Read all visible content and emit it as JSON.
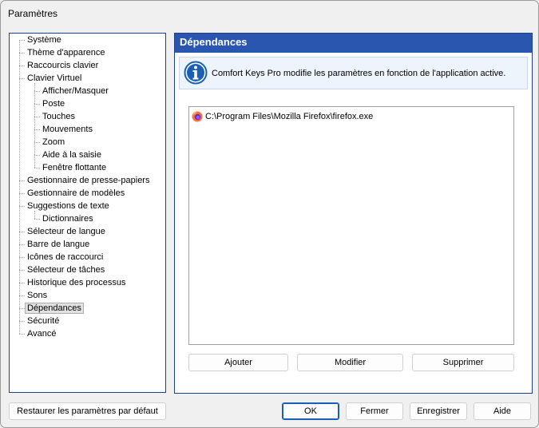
{
  "window": {
    "title": "Paramètres"
  },
  "tree": {
    "items": [
      {
        "label": "Système",
        "level": 0
      },
      {
        "label": "Thème d'apparence",
        "level": 0
      },
      {
        "label": "Raccourcis clavier",
        "level": 0
      },
      {
        "label": "Clavier Virtuel",
        "level": 0
      },
      {
        "label": "Afficher/Masquer",
        "level": 1
      },
      {
        "label": "Poste",
        "level": 1
      },
      {
        "label": "Touches",
        "level": 1
      },
      {
        "label": "Mouvements",
        "level": 1
      },
      {
        "label": "Zoom",
        "level": 1
      },
      {
        "label": "Aide à la saisie",
        "level": 1
      },
      {
        "label": "Fenêtre flottante",
        "level": 1
      },
      {
        "label": "Gestionnaire de presse-papiers",
        "level": 0
      },
      {
        "label": "Gestionnaire de modèles",
        "level": 0
      },
      {
        "label": "Suggestions de texte",
        "level": 0
      },
      {
        "label": "Dictionnaires",
        "level": 1
      },
      {
        "label": "Sélecteur de langue",
        "level": 0
      },
      {
        "label": "Barre de langue",
        "level": 0
      },
      {
        "label": "Icônes de raccourci",
        "level": 0
      },
      {
        "label": "Sélecteur de tâches",
        "level": 0
      },
      {
        "label": "Historique des processus",
        "level": 0
      },
      {
        "label": "Sons",
        "level": 0
      },
      {
        "label": "Dépendances",
        "level": 0,
        "selected": true
      },
      {
        "label": "Sécurité",
        "level": 0
      },
      {
        "label": "Avancé",
        "level": 0
      }
    ]
  },
  "panel": {
    "header": "Dépendances",
    "info_text": "Comfort Keys Pro modifie les paramètres en fonction de l'application active.",
    "list": [
      {
        "icon": "firefox-icon",
        "path": "C:\\Program Files\\Mozilla Firefox\\firefox.exe"
      }
    ],
    "buttons": {
      "add": "Ajouter",
      "edit": "Modifier",
      "delete": "Supprimer"
    }
  },
  "footer": {
    "restore": "Restaurer les paramètres par défaut",
    "ok": "OK",
    "close": "Fermer",
    "save": "Enregistrer",
    "help": "Aide"
  },
  "colors": {
    "header_bg": "#2b56b0",
    "frame_border": "#1f3f8f",
    "info_bg": "#eef4fb",
    "info_icon": "#1a5fb4"
  }
}
